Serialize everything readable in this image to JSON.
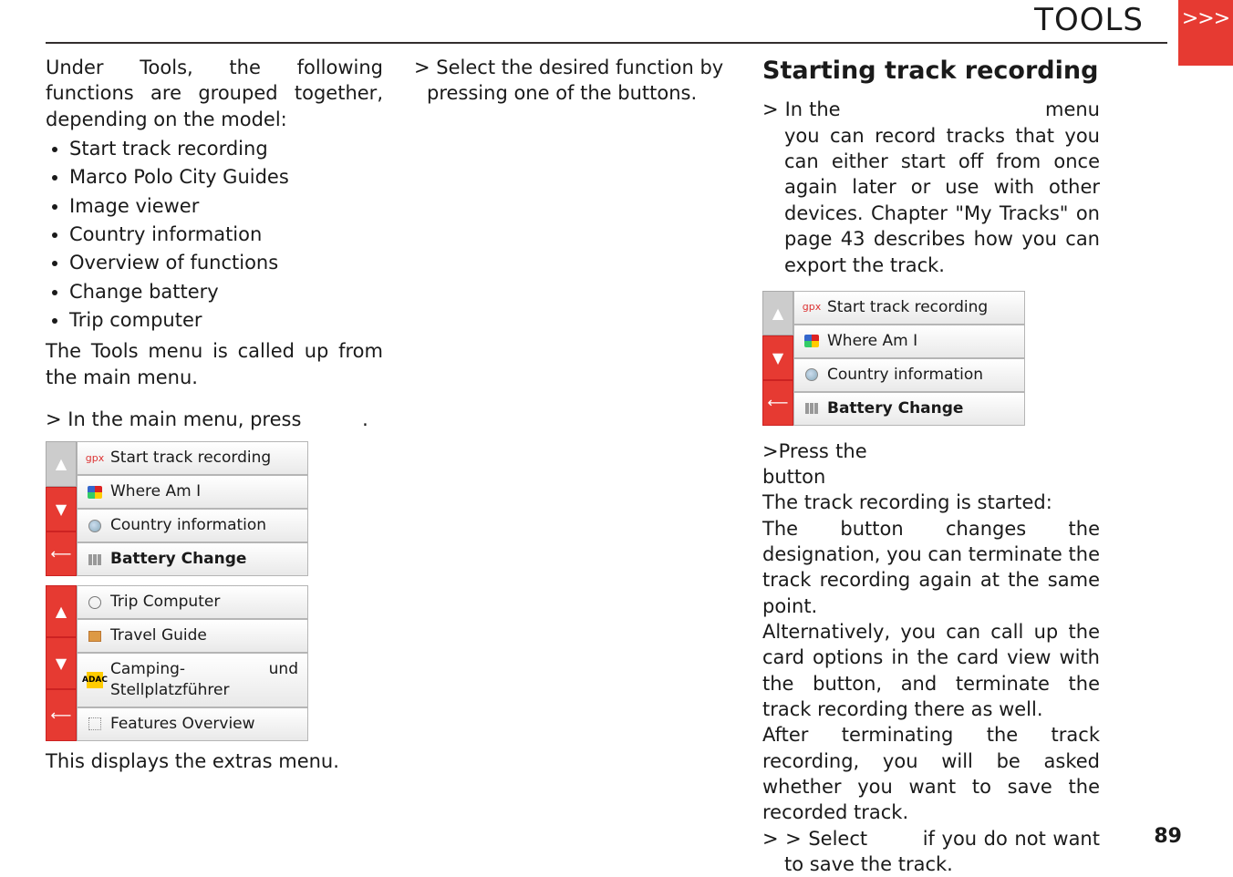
{
  "header": {
    "title": "TOOLS",
    "arrows": ">>>"
  },
  "col1": {
    "intro": "Under Tools, the following functions are grouped together, depending on the model:",
    "bullets": [
      "Start track recording",
      "Marco Polo City Guides",
      "Image viewer",
      "Country information",
      "Overview of functions",
      "Change battery",
      "Trip computer"
    ],
    "after": "The Tools menu is called up from the main menu.",
    "mainpress_pre": "> In the main menu, press ",
    "mainpress_post": ".",
    "caption": "This displays the extras menu."
  },
  "col2": {
    "select": "> Select the desired function by pressing one of the buttons."
  },
  "col3": {
    "heading": "Starting track recording",
    "inthe_pre": "> In the ",
    "inthe_post": " menu you can record tracks that you can either start off from once again later or use with other devices. Chapter \"My Tracks\" on page 43 describes how you can export the track.",
    "press_pre": ">Press the ",
    "press_post": " button",
    "started": "The track recording is started:",
    "button_changes": "The button changes the designation, you can terminate the track recording again at the same point.",
    "alt": "Alternatively, you can call up the card options in the card view with the      button, and terminate the track recording there as well.",
    "after_term": "After terminating the track recording, you will be asked whether you want to save the recorded track.",
    "selectno_pre": "> > Select ",
    "selectno_post": " if you do not want to save the track."
  },
  "menu1": {
    "items": [
      {
        "label": "Start track recording",
        "icon": "gpx"
      },
      {
        "label": "Where Am I",
        "icon": "pflag"
      },
      {
        "label": "Country information",
        "icon": "globe"
      },
      {
        "label": "Battery Change",
        "icon": "batt",
        "bold": true
      }
    ]
  },
  "menu2": {
    "items": [
      {
        "label": "Trip Computer",
        "icon": "clock"
      },
      {
        "label": "Travel Guide",
        "icon": "book"
      },
      {
        "label": "Camping- und Stellplatzführer",
        "icon": "adac",
        "badge": "ADAC"
      },
      {
        "label": "Features Overview",
        "icon": "feat"
      }
    ]
  },
  "menu3": {
    "items": [
      {
        "label": "Start track recording",
        "icon": "gpx"
      },
      {
        "label": "Where Am I",
        "icon": "pflag"
      },
      {
        "label": "Country information",
        "icon": "globe"
      },
      {
        "label": "Battery Change",
        "icon": "batt",
        "bold": true
      }
    ]
  },
  "footer": {
    "page": "89"
  }
}
